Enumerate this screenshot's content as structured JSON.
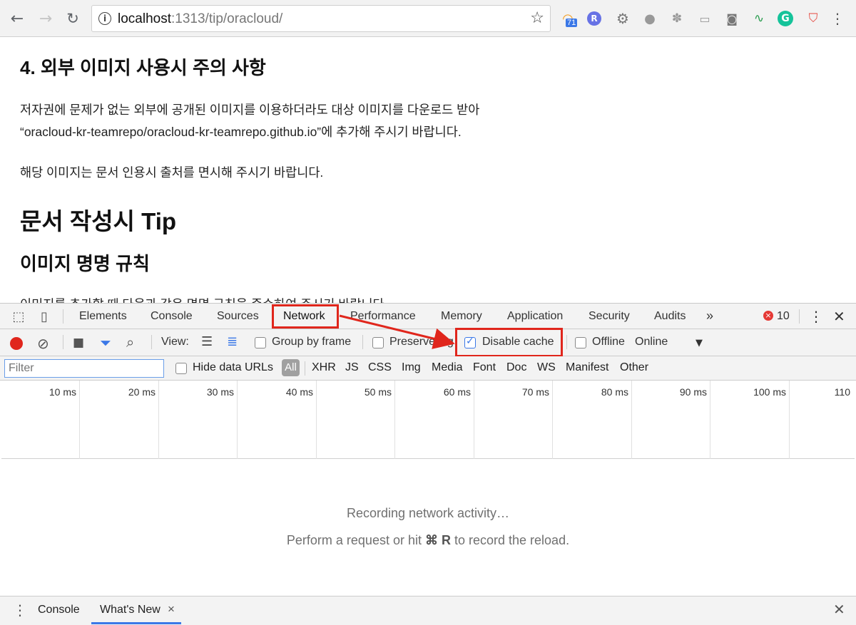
{
  "browser": {
    "url_host": "localhost",
    "url_path": ":1313/tip/oracloud/",
    "extension_badge": "71"
  },
  "page": {
    "heading_section4": "4. 외부 이미지 사용시 주의 사항",
    "para1_line1": "저자권에 문제가 없는 외부에 공개된 이미지를 이용하더라도 대상 이미지를 다운로드 받아",
    "para1_line2": "“oracloud-kr-teamrepo/oracloud-kr-teamrepo.github.io”에 추가해 주시기 바랍니다.",
    "para2": "해당 이미지는 문서 인용시 출처를 면시해 주시기 바랍니다.",
    "heading_tip": "문서 작성시 Tip",
    "heading_naming": "이미지 명명 규칙",
    "para3_cut": "이미지를 추가할 때 다음과 같은 명명 규칙을 준수하여 주시기 바랍니다."
  },
  "devtools": {
    "tabs": [
      "Elements",
      "Console",
      "Sources",
      "Network",
      "Performance",
      "Memory",
      "Application",
      "Security",
      "Audits"
    ],
    "more_tabs": "»",
    "error_count": "10",
    "toolbar": {
      "view_label": "View:",
      "group_by_frame": "Group by frame",
      "preserve_log": "Preserve log",
      "disable_cache": "Disable cache",
      "disable_cache_checked": true,
      "offline": "Offline",
      "throttle": "Online"
    },
    "filter": {
      "placeholder": "Filter",
      "hide_data_urls": "Hide data URLs",
      "types": [
        "All",
        "XHR",
        "JS",
        "CSS",
        "Img",
        "Media",
        "Font",
        "Doc",
        "WS",
        "Manifest",
        "Other"
      ]
    },
    "timeline_ticks": [
      "10 ms",
      "20 ms",
      "30 ms",
      "40 ms",
      "50 ms",
      "60 ms",
      "70 ms",
      "80 ms",
      "90 ms",
      "100 ms",
      "110"
    ],
    "empty": {
      "line1": "Recording network activity…",
      "line2_prefix": "Perform a request or hit ",
      "line2_key": "⌘ R",
      "line2_suffix": " to record the reload."
    },
    "drawer": {
      "tabs": [
        "Console",
        "What's New"
      ],
      "close_tab": "×"
    }
  },
  "annotation_color": "#e0261c"
}
